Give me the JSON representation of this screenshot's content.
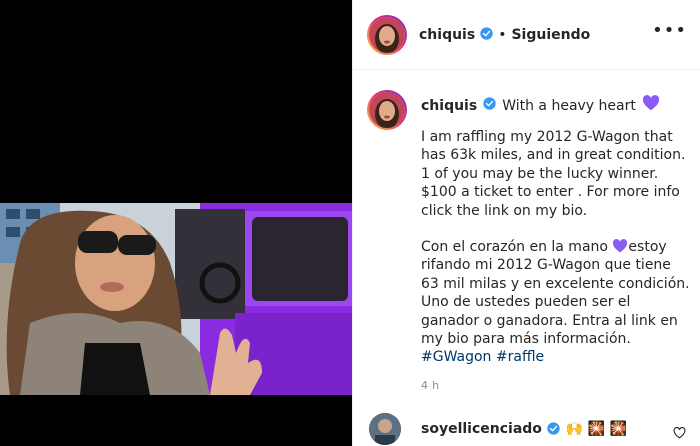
{
  "header": {
    "username": "chiquis",
    "separator": "•",
    "follow_label": "Siguiendo",
    "more_label": "•••"
  },
  "caption": {
    "username": "chiquis",
    "headline": "With a heavy heart",
    "headline_emoji": "purple-heart",
    "paragraph_en": "I am raffling my 2012 G-Wagon that\nhas 63k miles, and in great condition.\n1 of you may be the lucky winner.\n$100 a ticket to enter . For more info\nclick the link on my bio.",
    "paragraph_es_1": "Con el corazón en la mano",
    "paragraph_es_2": "estoy\nrifando mi 2012 G-Wagon que tiene\n63 mil milas y en excelente condición.\nUno de ustedes pueden ser el\nganador o ganadora. Entra al link en\nmy bio para más información.",
    "hashtag_1": "#GWagon",
    "hashtag_2": "#raffle"
  },
  "timestamp": "4 h",
  "comment": {
    "username": "soyellicenciado",
    "text": "🙌 🎇 🎇"
  },
  "colors": {
    "accent_link": "#00376b",
    "verified": "#3897f0",
    "purple_heart": "#8a5cf5",
    "vehicle": "#8a2be2"
  }
}
